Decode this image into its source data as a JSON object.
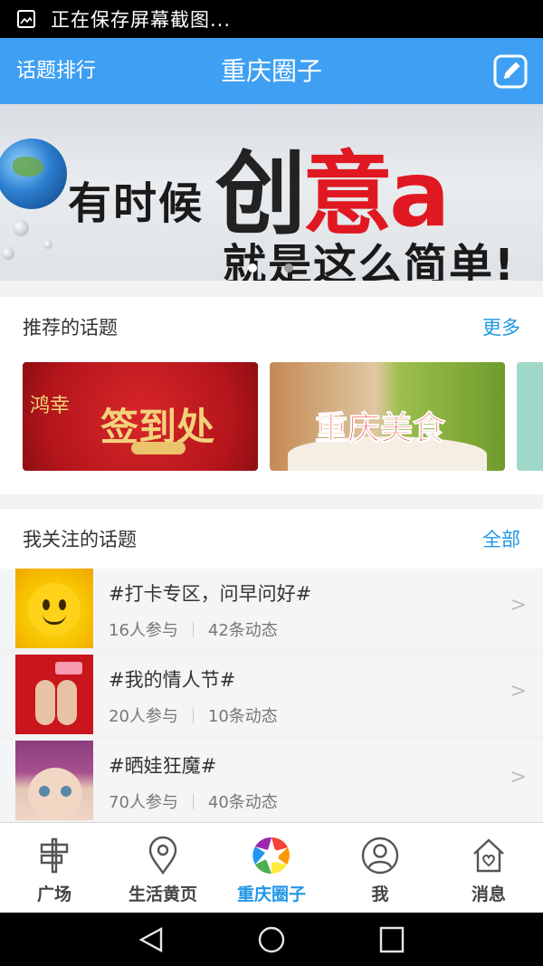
{
  "status_bar": {
    "icon": "screenshot-icon",
    "text": "正在保存屏幕截图..."
  },
  "header": {
    "left_label": "话题排行",
    "title": "重庆圈子",
    "right_icon": "edit-icon"
  },
  "banner": {
    "line1": "有时候",
    "line2_a": "创",
    "line2_b": "意",
    "line2_c": "a",
    "line3": "就是这么简单!",
    "page_count": 2,
    "active_page": 1
  },
  "recommended": {
    "title": "推荐的话题",
    "more_label": "更多",
    "items": [
      {
        "label": "签到处",
        "side": "鸿幸"
      },
      {
        "label": "重庆美食"
      }
    ]
  },
  "followed": {
    "title": "我关注的话题",
    "all_label": "全部",
    "items": [
      {
        "name": "#打卡专区，问早问好#",
        "participants": "16人参与",
        "posts": "42条动态"
      },
      {
        "name": "#我的情人节#",
        "participants": "20人参与",
        "posts": "10条动态"
      },
      {
        "name": "#晒娃狂魔#",
        "participants": "70人参与",
        "posts": "40条动态"
      }
    ],
    "chevron": ">"
  },
  "tabbar": {
    "items": [
      {
        "label": "广场",
        "icon": "signpost-icon"
      },
      {
        "label": "生活黄页",
        "icon": "location-pin-icon"
      },
      {
        "label": "重庆圈子",
        "icon": "aperture-icon"
      },
      {
        "label": "我",
        "icon": "user-icon"
      },
      {
        "label": "消息",
        "icon": "home-heart-icon"
      }
    ],
    "active": "重庆圈子"
  },
  "colors": {
    "accent": "#3fa0f3",
    "link": "#2196e6",
    "banner_red": "#e01822"
  }
}
